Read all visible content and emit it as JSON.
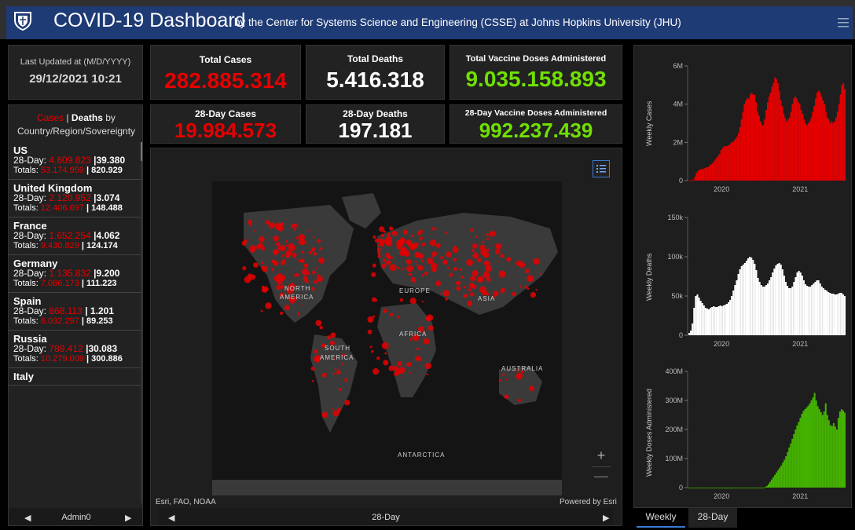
{
  "header": {
    "title": "COVID-19 Dashboard",
    "subtitle": "by the Center for Systems Science and Engineering (CSSE) at Johns Hopkins University (JHU)"
  },
  "updated": {
    "label": "Last Updated at (M/D/YYYY)",
    "value": "29/12/2021 10:21"
  },
  "stats": {
    "total_cases": {
      "label": "Total Cases",
      "value": "282.885.314"
    },
    "total_deaths": {
      "label": "Total Deaths",
      "value": "5.416.318"
    },
    "total_vaccine": {
      "label": "Total Vaccine Doses Administered",
      "value": "9.035.158.893"
    },
    "day28_cases": {
      "label": "28-Day Cases",
      "value": "19.984.573"
    },
    "day28_deaths": {
      "label": "28-Day Deaths",
      "value": "197.181"
    },
    "day28_vaccine": {
      "label": "28-Day Vaccine Doses Administered",
      "value": "992.237.439"
    }
  },
  "list": {
    "header_cases": "Cases",
    "header_sep": " | ",
    "header_deaths": "Deaths",
    "header_by": " by",
    "header_line2": "Country/Region/Sovereignty",
    "items": [
      {
        "name": "US",
        "d28_label": "28-Day: ",
        "d28_cases": "4.609.823",
        "d28_sep": " |",
        "d28_deaths": "39.380",
        "tot_label": "Totals: ",
        "tot_cases": "53.174.959",
        "tot_sep": " | ",
        "tot_deaths": "820.929"
      },
      {
        "name": "United Kingdom",
        "d28_label": "28-Day: ",
        "d28_cases": "2.120.952",
        "d28_sep": " |",
        "d28_deaths": "3.074",
        "tot_label": "Totals: ",
        "tot_cases": "12.406.697",
        "tot_sep": " | ",
        "tot_deaths": "148.488"
      },
      {
        "name": "France",
        "d28_label": "28-Day: ",
        "d28_cases": "1.652.254",
        "d28_sep": " |",
        "d28_deaths": "4.062",
        "tot_label": "Totals: ",
        "tot_cases": "9.430.829",
        "tot_sep": " | ",
        "tot_deaths": "124.174"
      },
      {
        "name": "Germany",
        "d28_label": "28-Day: ",
        "d28_cases": "1.135.832",
        "d28_sep": " |",
        "d28_deaths": "9.200",
        "tot_label": "Totals: ",
        "tot_cases": "7.086.173",
        "tot_sep": " | ",
        "tot_deaths": "111.223"
      },
      {
        "name": "Spain",
        "d28_label": "28-Day: ",
        "d28_cases": "868.113",
        "d28_sep": " | ",
        "d28_deaths": "1.201",
        "tot_label": "Totals: ",
        "tot_cases": "6.032.297",
        "tot_sep": " | ",
        "tot_deaths": "89.253"
      },
      {
        "name": "Russia",
        "d28_label": "28-Day: ",
        "d28_cases": "789.412",
        "d28_sep": " |",
        "d28_deaths": "30.083",
        "tot_label": "Totals: ",
        "tot_cases": "10.279.009",
        "tot_sep": " | ",
        "tot_deaths": "300.886"
      },
      {
        "name": "Italy",
        "d28_label": "",
        "d28_cases": "",
        "d28_sep": "",
        "d28_deaths": "",
        "tot_label": "",
        "tot_cases": "",
        "tot_sep": "",
        "tot_deaths": ""
      }
    ],
    "pager_label": "Admin0",
    "pager_left": "◀",
    "pager_right": "▶"
  },
  "map": {
    "credit": "Esri, FAO, NOAA",
    "powered": "Powered by Esri",
    "pager_label": "28-Day",
    "pager_left": "◀",
    "pager_right": "▶",
    "zoom_in": "+",
    "zoom_out": "—",
    "labels": {
      "north_america_1": "NORTH",
      "north_america_2": "AMERICA",
      "south_america_1": "SOUTH",
      "south_america_2": "AMERICA",
      "europe": "EUROPE",
      "asia": "ASIA",
      "africa": "AFRICA",
      "australia": "AUSTRALIA",
      "antarctica": "ANTARCTICA"
    },
    "dot_color": "#e60000"
  },
  "tabs": {
    "weekly": "Weekly",
    "day28": "28-Day"
  },
  "colors": {
    "cases": "#e60000",
    "deaths": "#ffffff",
    "vaccine": "#44b300",
    "header": "#1f3b75",
    "accent": "#3b7bd4"
  },
  "chart_data": [
    {
      "type": "bar",
      "ylabel": "Weekly Cases",
      "ylim": [
        0,
        6000000
      ],
      "yticks": [
        "0",
        "2M",
        "4M",
        "6M"
      ],
      "xticks": [
        "2020",
        "2021"
      ],
      "color": "#e60000",
      "values": [
        0.01,
        0.01,
        0.02,
        0.05,
        0.2,
        0.4,
        0.5,
        0.55,
        0.6,
        0.6,
        0.62,
        0.65,
        0.7,
        0.7,
        0.78,
        0.85,
        0.9,
        1.0,
        1.1,
        1.2,
        1.3,
        1.4,
        1.6,
        1.7,
        1.8,
        1.8,
        1.8,
        1.85,
        1.9,
        2.0,
        2.0,
        2.1,
        2.2,
        2.3,
        2.5,
        2.8,
        3.2,
        3.6,
        4.0,
        4.2,
        4.3,
        4.3,
        4.5,
        4.6,
        4.5,
        4.5,
        4.1,
        3.6,
        3.4,
        3.1,
        2.9,
        2.9,
        3.2,
        3.7,
        4.1,
        4.4,
        4.6,
        4.9,
        5.1,
        5.4,
        5.3,
        5.1,
        4.7,
        4.2,
        3.9,
        3.5,
        3.3,
        3.1,
        3.2,
        3.3,
        3.6,
        4.0,
        4.3,
        4.4,
        4.3,
        4.1,
        4.0,
        3.7,
        3.5,
        3.2,
        3.0,
        2.9,
        3.0,
        3.1,
        3.3,
        3.6,
        3.9,
        4.3,
        4.6,
        4.7,
        4.6,
        4.4,
        4.2,
        4.0,
        3.6,
        3.3,
        3.2,
        3.0,
        3.1,
        3.0,
        3.1,
        3.3,
        3.6,
        4.0,
        4.5,
        5.0,
        5.1,
        4.8
      ]
    },
    {
      "type": "bar",
      "ylabel": "Weekly Deaths",
      "ylim": [
        0,
        150000
      ],
      "yticks": [
        "0",
        "50k",
        "100k",
        "150k"
      ],
      "xticks": [
        "2020",
        "2021"
      ],
      "color": "#ffffff",
      "values": [
        3,
        6,
        15,
        35,
        50,
        52,
        48,
        44,
        41,
        38,
        35,
        34,
        33,
        35,
        36,
        37,
        36,
        36,
        37,
        38,
        37,
        38,
        39,
        40,
        42,
        45,
        50,
        57,
        64,
        70,
        78,
        84,
        88,
        90,
        92,
        95,
        98,
        100,
        99,
        96,
        91,
        83,
        73,
        68,
        64,
        62,
        62,
        64,
        66,
        70,
        74,
        80,
        85,
        89,
        91,
        92,
        90,
        84,
        76,
        68,
        63,
        60,
        60,
        62,
        68,
        74,
        80,
        82,
        80,
        76,
        70,
        65,
        63,
        62,
        62,
        64,
        66,
        68,
        70,
        70,
        66,
        62,
        60,
        58,
        57,
        55,
        54,
        53,
        53,
        52,
        52,
        53,
        54,
        54,
        52,
        50
      ]
    },
    {
      "type": "bar",
      "ylabel": "Weekly Doses Administered",
      "ylim": [
        0,
        400000000
      ],
      "yticks": [
        "0",
        "100M",
        "200M",
        "300M",
        "400M"
      ],
      "xticks": [
        "2020",
        "2021"
      ],
      "color": "#44b300",
      "values": [
        0,
        0,
        0,
        0,
        0,
        0,
        0,
        0,
        0,
        0,
        0,
        0,
        0,
        0,
        0,
        0,
        0,
        0,
        0,
        0,
        0,
        0,
        0,
        0,
        0,
        0,
        0,
        0,
        0,
        0,
        0,
        0,
        0,
        0,
        0,
        0,
        0,
        0,
        0,
        0,
        0,
        0,
        0,
        0,
        0,
        0,
        0,
        0,
        2,
        6,
        12,
        20,
        28,
        36,
        44,
        52,
        60,
        68,
        76,
        86,
        96,
        108,
        122,
        138,
        152,
        168,
        184,
        200,
        214,
        226,
        240,
        254,
        264,
        270,
        276,
        282,
        290,
        300,
        310,
        326,
        300,
        280,
        270,
        260,
        250,
        262,
        290,
        250,
        232,
        215,
        212,
        222,
        210,
        200,
        240,
        262,
        270,
        265,
        258
      ]
    }
  ]
}
